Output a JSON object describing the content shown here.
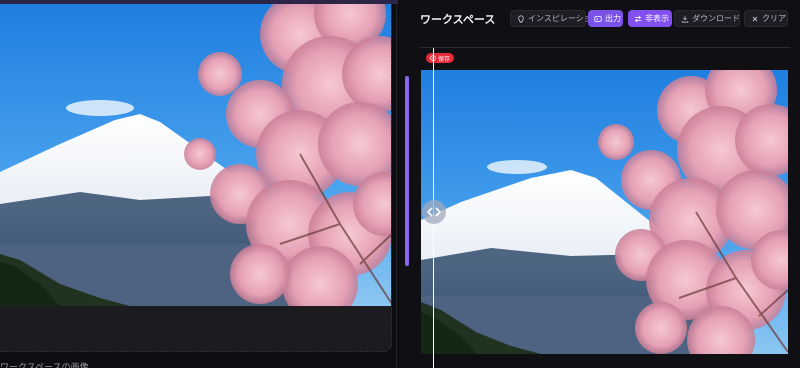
{
  "left": {
    "caption": "ワークスペースの画像"
  },
  "workspace": {
    "title": "ワークスペース",
    "toolbar": {
      "inspiration": "インスピレーション",
      "output": "出力",
      "hide": "非表示",
      "download": "ダウンロード",
      "clear": "クリア"
    },
    "save_badge": "保存"
  },
  "colors": {
    "accent": "#8250f0",
    "badge": "#e8293a",
    "background": "#101014"
  },
  "icons": [
    "bulb-icon",
    "output-icon",
    "hide-icon",
    "download-icon",
    "clear-icon",
    "pin-icon",
    "split-arrows-icon"
  ]
}
